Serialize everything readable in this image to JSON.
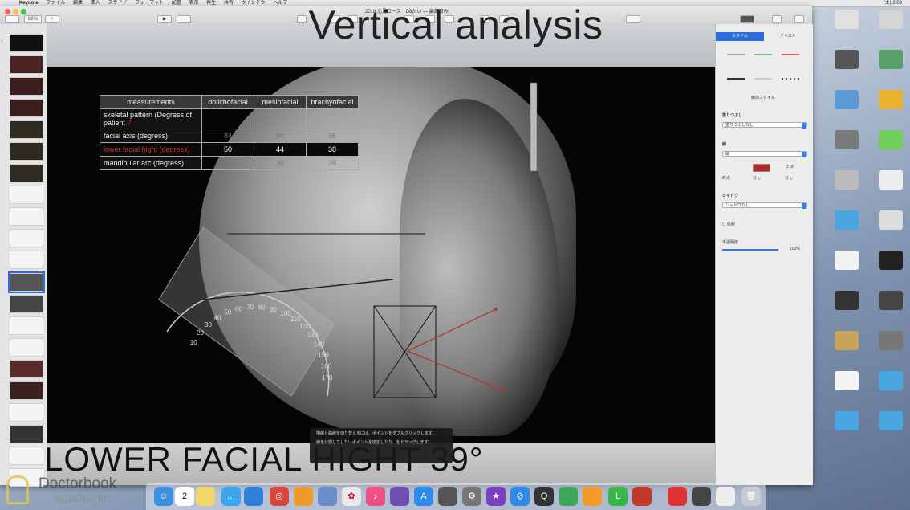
{
  "menubar": {
    "app": "Keynote",
    "items": [
      "ファイル",
      "編集",
      "挿入",
      "スライド",
      "フォーマット",
      "配置",
      "表示",
      "再生",
      "共有",
      "ウインドウ",
      "ヘルプ"
    ],
    "clock": "(土) 2:03"
  },
  "toolbar": {
    "zoom": "88%",
    "doc_title": "2018 北見コース　D8かい — 編集済み",
    "play": "▶"
  },
  "slide": {
    "title": "Vertical analysis",
    "footer_text": "LOWER FACIAL HIGHT 39°",
    "table": {
      "headers": [
        "measurements",
        "dolichofacial",
        "mesiofacial",
        "brachyofacial"
      ],
      "rows": [
        {
          "label": "skeletal pattern (Degress of patient",
          "marker": "?",
          "values": [
            "",
            "",
            ""
          ]
        },
        {
          "label": "facial axis (degress)",
          "values": [
            "84",
            "90",
            "96"
          ]
        },
        {
          "label": "lower facial hight (degress)",
          "values": [
            "50",
            "44",
            "38"
          ]
        },
        {
          "label": "mandibular arc (degress)",
          "values": [
            "22",
            "30",
            "38"
          ]
        }
      ]
    },
    "protractor_labels": [
      "10",
      "20",
      "30",
      "40",
      "50",
      "60",
      "70",
      "80",
      "90",
      "100",
      "110",
      "120",
      "130",
      "140",
      "150",
      "160",
      "170"
    ]
  },
  "tooltip": {
    "line1": "描線と曲線を切り替えるには、ポイントをダブルクリックします。",
    "line2": "線を分割してしたいポイントを追加したり、をドラッグします。"
  },
  "inspector": {
    "tabs": [
      "スタイル",
      "テキスト"
    ],
    "style_label": "線のスタイル",
    "fill": "塗りつぶし",
    "fill_value": "塗りつぶしなし",
    "stroke": "線",
    "stroke_value": "線",
    "stroke_width": "2 pt",
    "endpoints": "終点",
    "end_left": "なし",
    "end_right": "なし",
    "shadow": "シャドウ",
    "shadow_value": "シャドウなし",
    "reflection": "反射",
    "opacity_label": "不透明度",
    "opacity_value": "100%",
    "stroke_color": "#b02a22"
  },
  "watermark": {
    "line1": "Doctorbook",
    "line2": "academic"
  },
  "dock": {
    "items": [
      "finder",
      "calendar",
      "notes",
      "messages",
      "keynote",
      "chrome",
      "pages",
      "preview",
      "photos",
      "itunes",
      "ibooks",
      "appstore",
      "xcode",
      "system-prefs",
      "imovie",
      "safari",
      "quicktime",
      "numbers",
      "line",
      "acrobat",
      "photo-booth",
      "trash"
    ],
    "calendar_day": "2"
  }
}
